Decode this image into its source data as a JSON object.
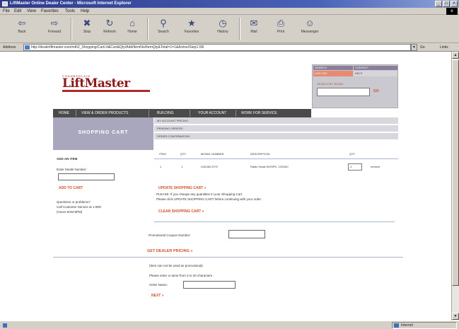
{
  "window": {
    "title": "LiftMaster Online Dealer Center - Microsoft Internet Explorer",
    "controls": [
      "_",
      "□",
      "×"
    ]
  },
  "menu": [
    "File",
    "Edit",
    "View",
    "Favorites",
    "Tools",
    "Help"
  ],
  "toolbar": [
    {
      "label": "Back",
      "icon": "back-arrow-icon",
      "glyph": "⇦"
    },
    {
      "label": "Forward",
      "icon": "forward-arrow-icon",
      "glyph": "⇨"
    },
    {
      "label": "Stop",
      "icon": "stop-icon",
      "glyph": "✖"
    },
    {
      "label": "Refresh",
      "icon": "refresh-icon",
      "glyph": "↻"
    },
    {
      "label": "Home",
      "icon": "home-icon",
      "glyph": "⌂"
    },
    {
      "label": "Search",
      "icon": "search-icon",
      "glyph": "⚲"
    },
    {
      "label": "Favorites",
      "icon": "favorites-icon",
      "glyph": "★"
    },
    {
      "label": "History",
      "icon": "history-icon",
      "glyph": "◷"
    },
    {
      "label": "Mail",
      "icon": "mail-icon",
      "glyph": "✉"
    },
    {
      "label": "Print",
      "icon": "print-icon",
      "glyph": "⎙"
    },
    {
      "label": "Messenger",
      "icon": "messenger-icon",
      "glyph": "☺"
    }
  ],
  "address": {
    "label": "Address",
    "url": "http://dealerlftmaster.com/mth2_Shopping/Cart/.d&Cart&Qty/Add/ItemNo/ItemQty&Total=1=1&Active/Step1-5R",
    "go": "Go",
    "links": "Links"
  },
  "status": {
    "text": "",
    "zone": "Internet"
  },
  "brand": {
    "tagline": "CHAMBERLAIN",
    "name": "LiftMaster",
    "accent": "#8b1a1a"
  },
  "account": {
    "head_left": "SEARCH",
    "head_right": "CONTACT",
    "tab_left": "LOG OUT",
    "tab_right": "HELP",
    "label": "SEARCH BY MODEL",
    "go": "GO"
  },
  "nav": [
    "HOME",
    "VIEW & ORDER PRODUCTS",
    "BUILDING",
    "YOUR ACCOUNT",
    "WORK FOR SERVICE"
  ],
  "hero": {
    "title": "SHOPPING CART"
  },
  "subnav": [
    "MY ACCOUNT PRICING",
    "PENDING ORDERS",
    "ORDER CONFIRMATION"
  ],
  "cart": {
    "headers": [
      "ITEM",
      "QTY",
      "MODEL NUMBER",
      "DESCRIPTION",
      "QTY"
    ],
    "rows": [
      {
        "item": "1",
        "qty": "1",
        "model": "LM1260-SYS",
        "description": "Radio Head HD/SPK, 120VAC",
        "qty_value": "1",
        "action": "remove"
      }
    ]
  },
  "left": {
    "add_title": "ADD AN ITEM",
    "model_label": "Enter Model Number:",
    "add_button": "ADD TO CART",
    "q1": "Questions or problems?",
    "q2": "Call Customer Service at 1-800-",
    "q3": "(Hours 8AM-8PM)"
  },
  "actions": {
    "update": "UPDATE SHOPPING CART »",
    "notice1": "PLEASE: If you change any quantities in your Shopping Cart,",
    "notice2": "Please click UPDATE SHOPPING CART before continuing with your order.",
    "clear": "CLEAR SHOPPING CART »"
  },
  "promo": {
    "label": "Promotional Coupon Number:"
  },
  "checkout": {
    "title": "GET DEALER PRICING »",
    "line1": "(Item can not be used as promotional)",
    "line2": "Please enter a name from 3 to 20 characters",
    "order_label": "Order Name:",
    "next": "NEXT »"
  }
}
